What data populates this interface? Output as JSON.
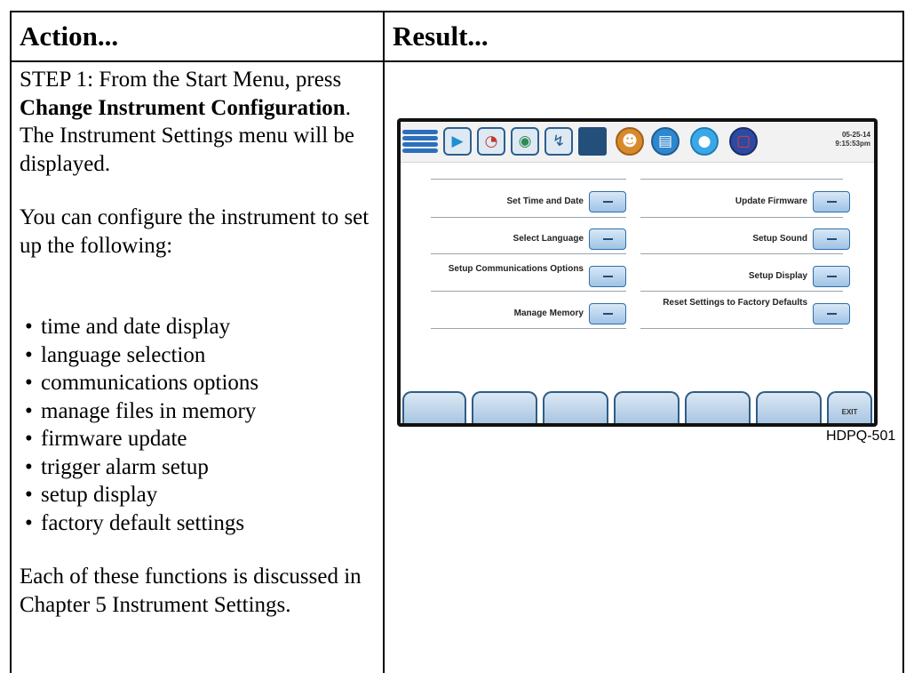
{
  "table": {
    "header_action": "Action...",
    "header_result": "Result..."
  },
  "step": {
    "prefix": "STEP 1: From the Start Menu, press ",
    "bold": "Change Instrument Configuration",
    "suffix": ". The Instrument Settings menu will be displayed."
  },
  "intro": "You can configure the instrument to set up the following:",
  "bullets": [
    "time and date display",
    "language selection",
    "communications options",
    "manage files in memory",
    "firmware update",
    "trigger alarm setup",
    "setup display",
    "factory default settings"
  ],
  "closing": "Each of these functions is discussed in Chapter 5 Instrument Settings.",
  "device": {
    "date": "05-25-14",
    "time": "9:15:53pm",
    "menu": {
      "set_time_date": "Set Time and Date",
      "select_language": "Select Language",
      "setup_comms": "Setup Communications Options",
      "manage_memory": "Manage Memory",
      "update_firmware": "Update Firmware",
      "setup_sound": "Setup Sound",
      "setup_display": "Setup Display",
      "reset_defaults": "Reset Settings to Factory Defaults"
    },
    "softkey_exit": "EXIT",
    "toolbar_icons": [
      "menu-icon",
      "play-icon",
      "gauge-icon",
      "eye-icon",
      "wrench-icon",
      "screen-icon",
      "camera-icon",
      "document-icon",
      "record-icon",
      "stop-icon"
    ]
  },
  "figure_id": "HDPQ-501"
}
